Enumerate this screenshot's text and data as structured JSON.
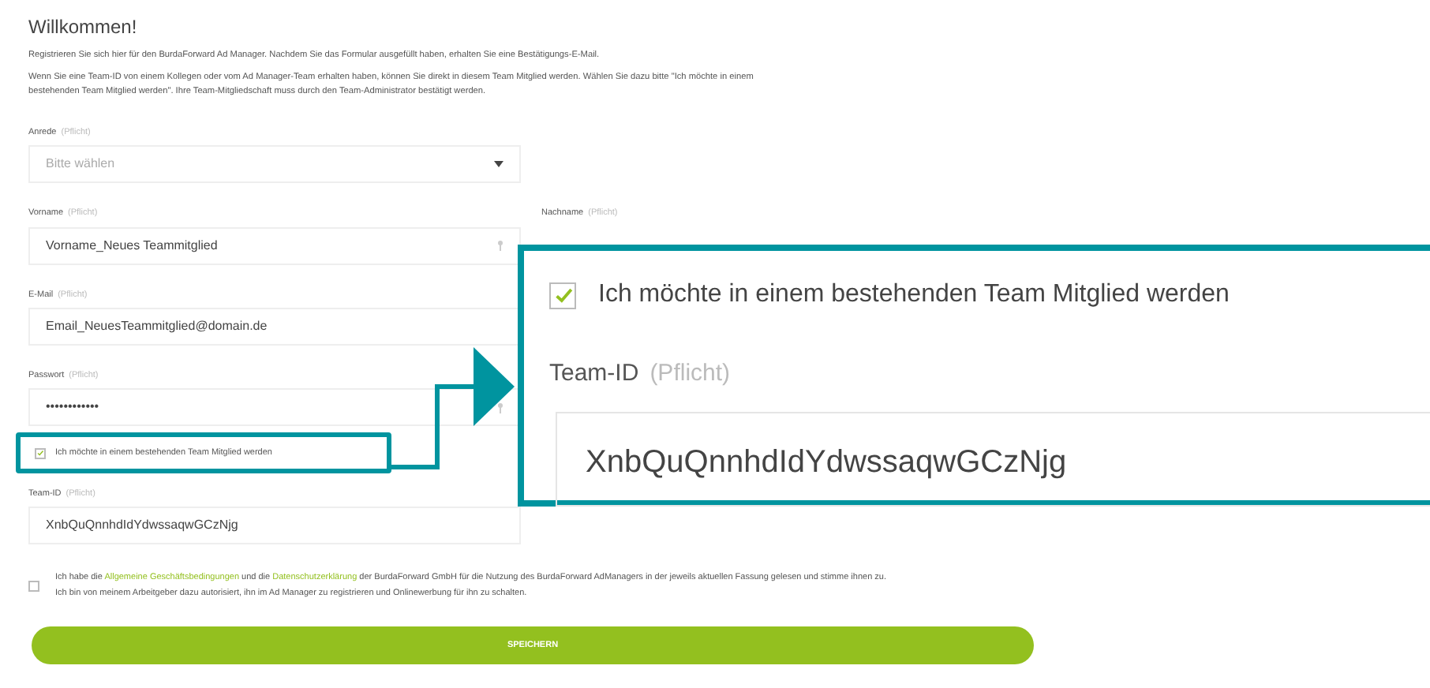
{
  "heading": "Willkommen!",
  "intro": [
    "Registrieren Sie sich hier für den BurdaForward Ad Manager. Nachdem Sie das Formular ausgefüllt haben, erhalten Sie eine Bestätigungs-E-Mail.",
    "Wenn Sie eine Team-ID von einem Kollegen oder vom Ad Manager-Team erhalten haben, können Sie direkt in diesem Team Mitglied werden. Wählen Sie dazu bitte \"Ich möchte in einem bestehenden Team Mitglied werden\". Ihre Team-Mitgliedschaft muss durch den Team-Administrator bestätigt werden."
  ],
  "salutation": {
    "label": "Anrede",
    "hint": "(Pflicht)",
    "placeholder": "Bitte wählen"
  },
  "first_name": {
    "label": "Vorname",
    "hint": "(Pflicht)",
    "value": "Vorname_Neues Teammitglied"
  },
  "last_name": {
    "label": "Nachname",
    "hint": "(Pflicht)"
  },
  "email": {
    "label": "E-Mail",
    "hint": "(Pflicht)",
    "value": "Email_NeuesTeammitglied@domain.de"
  },
  "password": {
    "label": "Passwort",
    "hint": "(Pflicht)",
    "value": "••••••••••••"
  },
  "join_team": {
    "label": "Ich möchte in einem bestehenden Team Mitglied werden",
    "checked": true
  },
  "team_id": {
    "label": "Team-ID",
    "hint": "(Pflicht)",
    "value": "XnbQuQnnhdIdYdwssaqwGCzNjg"
  },
  "terms": {
    "checked": false,
    "text_1": "Ich habe die",
    "link_1": "Allgemeine Geschäftsbedingungen",
    "text_2": "und die",
    "link_2": "Datenschutzerklärung",
    "text_3": "der BurdaForward GmbH für die Nutzung des BurdaForward AdManagers in der jeweils aktuellen Fassung gelesen und stimme ihnen zu.",
    "line_2": "Ich bin von meinem Arbeitgeber dazu autorisiert, ihn im Ad Manager zu registrieren und Onlinewerbung für ihn zu schalten."
  },
  "save_button": "SPEICHERN",
  "callout": {
    "checkbox_label": "Ich möchte in einem bestehenden Team Mitglied werden",
    "checked": true,
    "field_label": "Team-ID",
    "field_hint": "(Pflicht)",
    "field_value": "XnbQuQnnhdIdYdwssaqwGCzNjg"
  }
}
